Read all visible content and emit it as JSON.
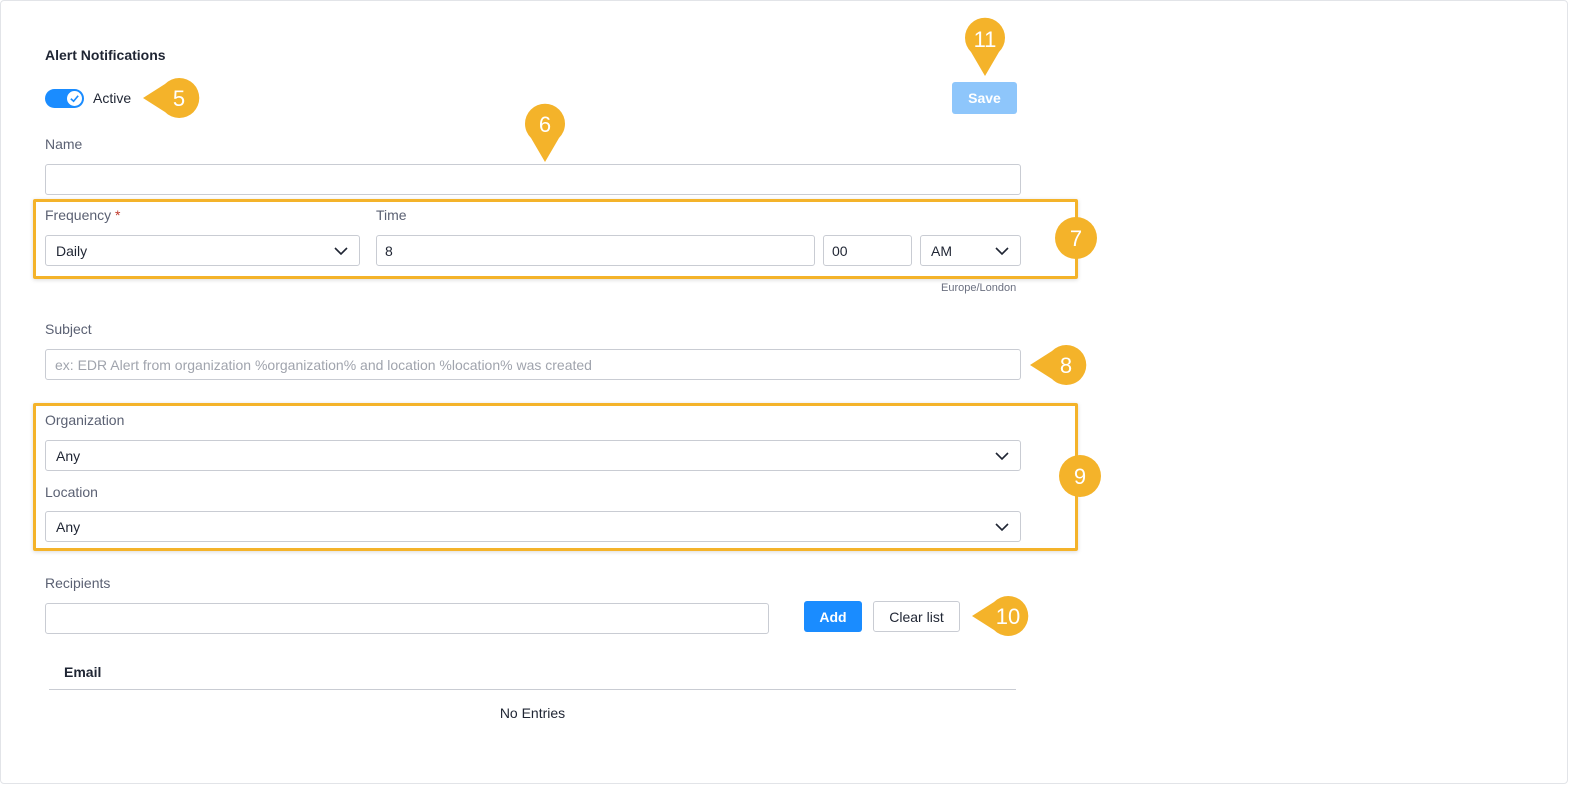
{
  "header": {
    "title": "Alert Notifications"
  },
  "toggle": {
    "label": "Active",
    "checked": true
  },
  "save_button": "Save",
  "name": {
    "label": "Name",
    "value": ""
  },
  "frequency": {
    "label": "Frequency",
    "required_marker": "*",
    "value": "Daily"
  },
  "time": {
    "label": "Time",
    "hour": "8",
    "minute": "00",
    "meridiem": "AM",
    "timezone": "Europe/London"
  },
  "subject": {
    "label": "Subject",
    "placeholder": "ex: EDR Alert from organization %organization% and location %location% was created",
    "value": ""
  },
  "organization": {
    "label": "Organization",
    "value": "Any"
  },
  "location": {
    "label": "Location",
    "value": "Any"
  },
  "recipients": {
    "label": "Recipients",
    "value": "",
    "add_button": "Add",
    "clear_button": "Clear list"
  },
  "table": {
    "column": "Email",
    "empty_text": "No Entries"
  },
  "callouts": [
    "5",
    "6",
    "7",
    "8",
    "9",
    "10",
    "11"
  ],
  "colors": {
    "accent": "#1a8cff",
    "callout": "#f4b32a",
    "save_disabled": "#8ec6fb"
  },
  "icons": {
    "toggle": "check-icon",
    "dropdown": "chevron-down-icon"
  }
}
